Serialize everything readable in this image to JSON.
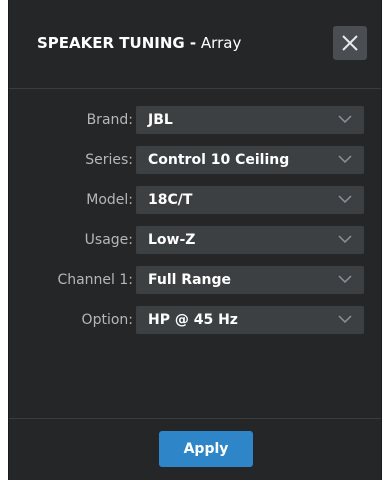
{
  "dialog": {
    "title_main": "SPEAKER TUNING -",
    "title_sub": " Array",
    "close_icon": "close-x-icon"
  },
  "fields": [
    {
      "label": "Brand:",
      "value": "JBL"
    },
    {
      "label": "Series:",
      "value": "Control 10 Ceiling"
    },
    {
      "label": "Model:",
      "value": "18C/T"
    },
    {
      "label": "Usage:",
      "value": "Low-Z"
    },
    {
      "label": "Channel 1:",
      "value": "Full Range"
    },
    {
      "label": "Option:",
      "value": "HP @ 45 Hz"
    }
  ],
  "footer": {
    "apply_label": "Apply"
  },
  "colors": {
    "dialog_bg": "#242628",
    "select_bg": "#3d4043",
    "accent": "#2e86c8",
    "label": "#b4b7bb"
  }
}
